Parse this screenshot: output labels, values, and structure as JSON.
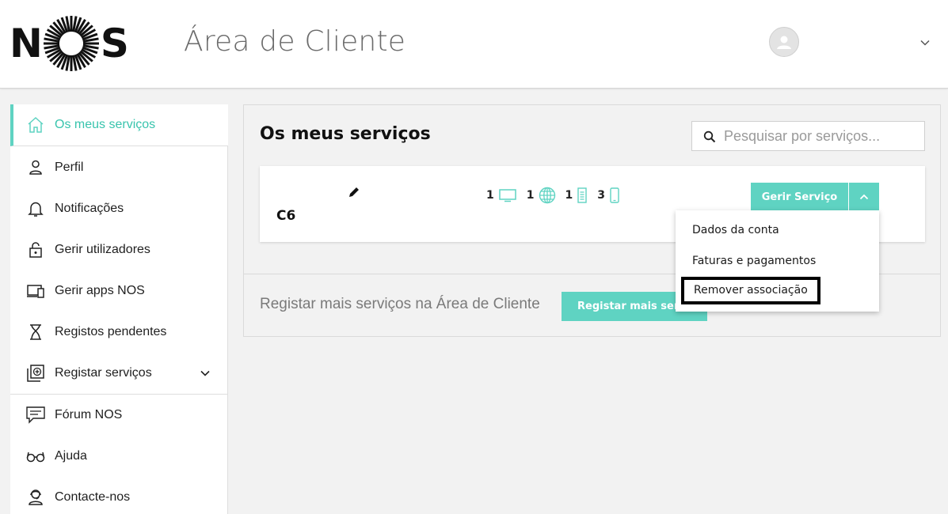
{
  "header": {
    "logo_left": "N",
    "logo_right": "S",
    "title": "Área de Cliente"
  },
  "sidebar": {
    "items": [
      {
        "label": "Os meus serviços",
        "icon": "home-icon"
      },
      {
        "label": "Perfil",
        "icon": "user-icon"
      },
      {
        "label": "Notificações",
        "icon": "bell-icon"
      },
      {
        "label": "Gerir utilizadores",
        "icon": "lock-icon"
      },
      {
        "label": "Gerir apps NOS",
        "icon": "devices-icon"
      },
      {
        "label": "Registos pendentes",
        "icon": "hourglass-icon"
      },
      {
        "label": "Registar serviços",
        "icon": "add-square-icon"
      },
      {
        "label": "Fórum NOS",
        "icon": "chat-icon"
      },
      {
        "label": "Ajuda",
        "icon": "glasses-icon"
      },
      {
        "label": "Contacte-nos",
        "icon": "headset-icon"
      }
    ]
  },
  "main": {
    "title": "Os meus serviços",
    "search_placeholder": "Pesquisar por serviços...",
    "service": {
      "name": "C6",
      "counts": [
        {
          "value": "1",
          "icon": "tv-icon"
        },
        {
          "value": "1",
          "icon": "globe-icon"
        },
        {
          "value": "1",
          "icon": "landline-icon"
        },
        {
          "value": "3",
          "icon": "mobile-icon"
        }
      ],
      "manage_label": "Gerir Serviço"
    },
    "register_text": "Registar mais serviços na Área de Cliente",
    "register_button": "Registar mais serviços"
  },
  "dropdown": {
    "items": [
      "Dados da conta",
      "Faturas e pagamentos",
      "Remover associação"
    ]
  },
  "colors": {
    "accent": "#5fd3c2",
    "accent_text": "#38c4ad"
  }
}
